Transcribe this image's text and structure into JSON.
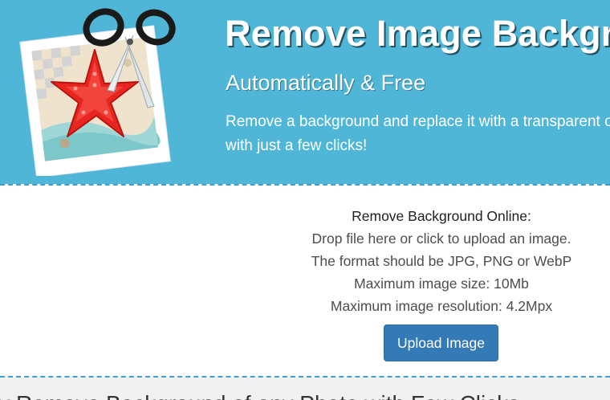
{
  "header": {
    "title": "Remove Image Background",
    "subtitle": "Automatically & Free",
    "description": "Remove a background and replace it with a transparent one with just a few clicks!",
    "logo_icon": "starfish-photo-scissors-icon"
  },
  "upload": {
    "heading": "Remove Background Online:",
    "instruction": "Drop file here or click to upload an image.",
    "format_note": "The format should be JPG, PNG or WebP",
    "max_size": "Maximum image size: 10Mb",
    "max_resolution": "Maximum image resolution: 4.2Mpx",
    "button_label": "Upload Image"
  },
  "section": {
    "heading": "ly Remove Background of any Photo with Few Clicks"
  },
  "colors": {
    "header_bg": "#4fb6d8",
    "button_bg": "#337ab7",
    "divider": "#3a9fd6",
    "starfish": "#e8251f"
  }
}
